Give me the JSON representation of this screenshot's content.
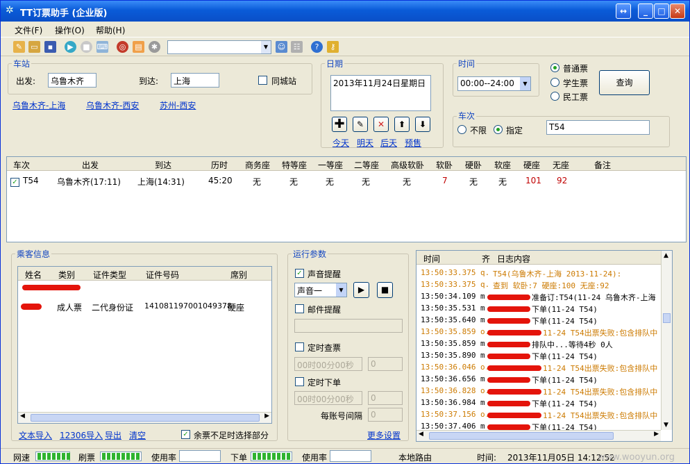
{
  "window": {
    "title": "TT订票助手 (企业版)",
    "btn_restore": "↔",
    "btn_min": "_",
    "btn_max": "□",
    "btn_close": "✕"
  },
  "menu": [
    "文件(F)",
    "操作(O)",
    "帮助(H)"
  ],
  "station": {
    "legend": "车站",
    "from_label": "出发:",
    "from_value": "乌鲁木齐",
    "to_label": "到达:",
    "to_value": "上海",
    "same_city": "同城站",
    "recent": [
      "乌鲁木齐-上海",
      "乌鲁木齐-西安",
      "苏州-西安"
    ]
  },
  "date": {
    "legend": "日期",
    "value": "2013年11月24日星期日",
    "links": [
      "今天",
      "明天",
      "后天",
      "预售"
    ]
  },
  "time": {
    "legend": "时间",
    "value": "00:00--24:00"
  },
  "ticket_type": {
    "options": [
      "普通票",
      "学生票",
      "民工票"
    ],
    "selected": 0
  },
  "query_button": "查询",
  "train": {
    "legend": "车次",
    "opt_any": "不限",
    "opt_specified": "指定",
    "value": "T54"
  },
  "table": {
    "headers": [
      "车次",
      "出发",
      "到达",
      "历时",
      "商务座",
      "特等座",
      "一等座",
      "二等座",
      "高级软卧",
      "软卧",
      "硬卧",
      "软座",
      "硬座",
      "无座",
      "备注"
    ],
    "rows": [
      {
        "train": "T54",
        "from": "乌鲁木齐(17:11)",
        "to": "上海(14:31)",
        "duration": "45:20",
        "business": "无",
        "special": "无",
        "first": "无",
        "second": "无",
        "senior_sleeper": "无",
        "soft_sleeper": "7",
        "hard_sleeper": "无",
        "soft_seat": "无",
        "hard_seat": "101",
        "no_seat": "92",
        "note": ""
      }
    ]
  },
  "passenger": {
    "legend": "乘客信息",
    "headers": [
      "姓名",
      "类别",
      "证件类型",
      "证件号码",
      "席别"
    ],
    "rows": [
      {
        "name": "",
        "type": "成人票",
        "id_type": "二代身份证",
        "id_no": "141081197001049378",
        "seat": "硬座"
      }
    ],
    "links": [
      "文本导入",
      "12306导入",
      "导出",
      "清空"
    ],
    "partial_label": "余票不足时选择部分"
  },
  "params": {
    "legend": "运行参数",
    "sound_label": "声音提醒",
    "sound_value": "声音一",
    "mail_label": "邮件提醒",
    "timed_query_label": "定时查票",
    "timed_query_value": "00时00分00秒",
    "timed_query_num": "0",
    "timed_order_label": "定时下单",
    "timed_order_value": "00时00分00秒",
    "timed_order_num": "0",
    "interval_label": "每账号间隔",
    "interval_value": "0",
    "more_link": "更多设置"
  },
  "log": {
    "headers": [
      "时间",
      "齐",
      "日志内容"
    ],
    "rows": [
      {
        "time": "13:50:33.375",
        "k": "q.",
        "msg": "T54(乌鲁木齐-上海 2013-11-24):",
        "color": "#cc7a00"
      },
      {
        "time": "13:50:33.375",
        "k": "q.",
        "msg": "查到 软卧:7 硬座:100 无座:92",
        "color": "#cc7a00"
      },
      {
        "time": "13:50:34.109",
        "k": "m",
        "msg": "准备订:T54(11-24 乌鲁木齐-上海",
        "color": "#000"
      },
      {
        "time": "13:50:35.531",
        "k": "m",
        "msg": "下单(11-24 T54)",
        "color": "#000"
      },
      {
        "time": "13:50:35.640",
        "k": "m",
        "msg": "下单(11-24 T54)",
        "color": "#000"
      },
      {
        "time": "13:50:35.859",
        "k": "o.",
        "msg": "11-24 T54出票失败:包含排队中",
        "color": "#cc7a00"
      },
      {
        "time": "13:50:35.859",
        "k": "m",
        "msg": "排队中...等待4秒 0人",
        "color": "#000"
      },
      {
        "time": "13:50:35.890",
        "k": "m",
        "msg": "下单(11-24 T54)",
        "color": "#000"
      },
      {
        "time": "13:50:36.046",
        "k": "o.",
        "msg": "11-24 T54出票失败:包含排队中",
        "color": "#cc7a00"
      },
      {
        "time": "13:50:36.656",
        "k": "m",
        "msg": "下单(11-24 T54)",
        "color": "#000"
      },
      {
        "time": "13:50:36.828",
        "k": "o.",
        "msg": "11-24 T54出票失败:包含排队中",
        "color": "#cc7a00"
      },
      {
        "time": "13:50:36.984",
        "k": "m",
        "msg": "下单(11-24 T54)",
        "color": "#000"
      },
      {
        "time": "13:50:37.156",
        "k": "o.",
        "msg": "11-24 T54出票失败:包含排队中",
        "color": "#cc7a00"
      },
      {
        "time": "13:50:37.406",
        "k": "m",
        "msg": "下单(11-24 T54)",
        "color": "#000"
      }
    ]
  },
  "status": {
    "net_label": "网速",
    "ticket_label": "刷票",
    "usage1_label": "使用率",
    "order_label": "下单",
    "usage2_label": "使用率",
    "route": "本地路由",
    "time_label": "时间:",
    "time_value": "2013年11月05日 14:12:52",
    "watermark": "www.wooyun.org"
  },
  "colors": {
    "title_blue": "#0a5bd8",
    "legend_blue": "#1346c1",
    "link_blue": "#0033cc",
    "red_value": "#c00000",
    "log_orange": "#cc7a00",
    "progress_green": "#2fb32f"
  }
}
